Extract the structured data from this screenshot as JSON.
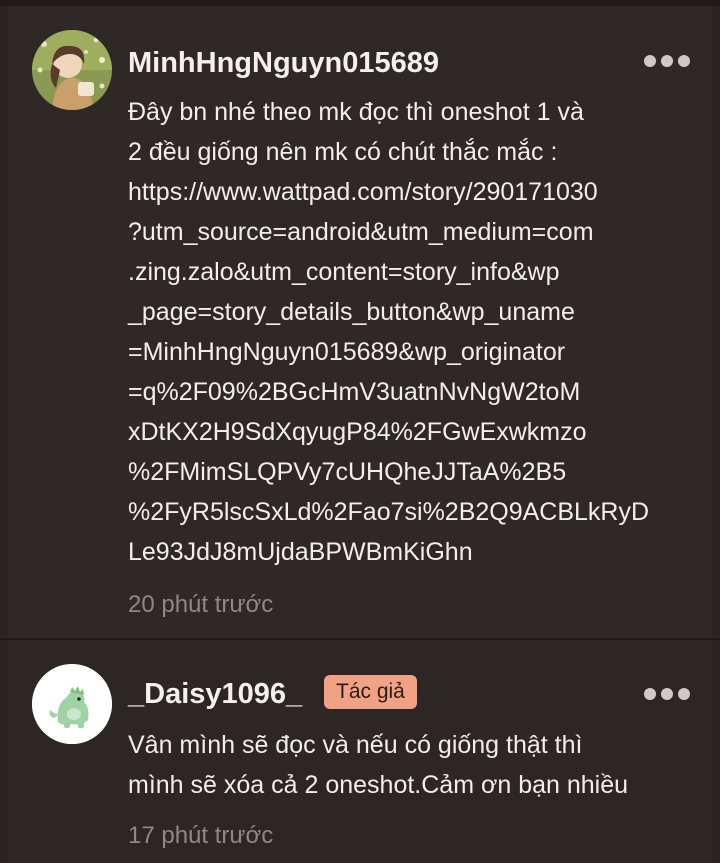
{
  "comments": [
    {
      "username": "MinhHngNguyn015689",
      "body_lines": [
        "Đây bn nhé theo mk đọc thì oneshot 1 và",
        "2 đều giống nên mk có chút thắc mắc :",
        "https://www.wattpad.com/story/290171030",
        "?utm_source=android&utm_medium=com",
        ".zing.zalo&utm_content=story_info&wp",
        "_page=story_details_button&wp_uname",
        "=MinhHngNguyn015689&wp_originator",
        "=q%2F09%2BGcHmV3uatnNvNgW2toM",
        "xDtKX2H9SdXqyugP84%2FGwExwkmzo",
        "%2FMimSLQPVy7cUHQheJJTaA%2B5",
        "%2FyR5lscSxLd%2Fao7si%2B2Q9ACBLkRyD",
        "Le93JdJ8mUjdaBPWBmKiGhn"
      ],
      "timestamp": "20 phút trước",
      "avatar_icon": "user-photo-avatar"
    },
    {
      "username": "_Daisy1096_",
      "badge": "Tác giả",
      "body_lines": [
        "Vân mình sẽ đọc và nếu có giống thật thì",
        "mình sẽ xóa cả 2 oneshot.Cảm ơn bạn nhiều"
      ],
      "timestamp": "17 phút trước",
      "avatar_icon": "green-dinosaur-avatar"
    }
  ],
  "colors": {
    "background": "#2e2926",
    "badge": "#f2a284",
    "text": "#f2eeec",
    "muted": "#8f8884"
  },
  "icons": {
    "more": "more-dots-icon"
  }
}
